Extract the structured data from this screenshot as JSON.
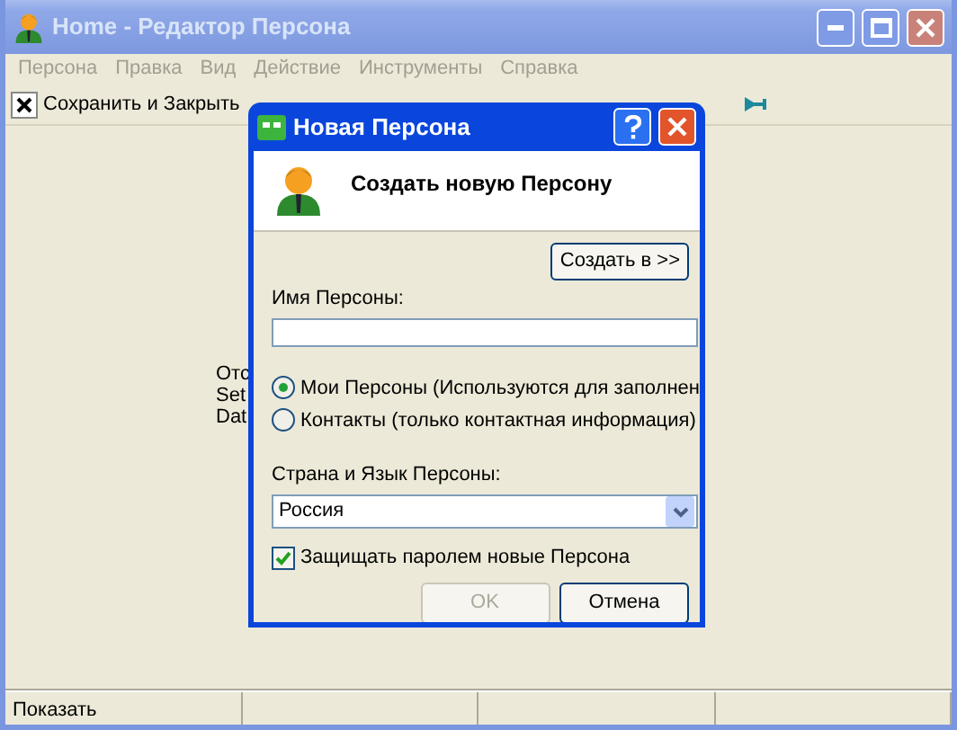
{
  "window": {
    "title": "Home - Редактор Персона",
    "active": false
  },
  "menu": [
    "Персона",
    "Правка",
    "Вид",
    "Действие",
    "Инструменты",
    "Справка"
  ],
  "toolbar": {
    "save_close": "Сохранить и Закрыть"
  },
  "background_labels": [
    "Отс",
    "Set",
    "Dat"
  ],
  "dialog": {
    "title": "Новая Персона",
    "heading": "Создать новую Персону",
    "create_in_button": "Создать в >>",
    "name_label": "Имя Персоны:",
    "options": [
      {
        "label": "Мои Персоны (Используются для заполнен",
        "selected": true
      },
      {
        "label": "Контакты (только контактная информация)",
        "selected": false
      }
    ],
    "country_label": "Страна и Язык Персоны:",
    "country_value": "Россия",
    "password": {
      "label": "Защищать паролем новые Персона",
      "checked": true
    },
    "buttons": [
      {
        "label": "OK",
        "disabled": true
      },
      {
        "label": "Отмена",
        "disabled": false
      }
    ]
  },
  "status_bar": [
    "Показать"
  ]
}
